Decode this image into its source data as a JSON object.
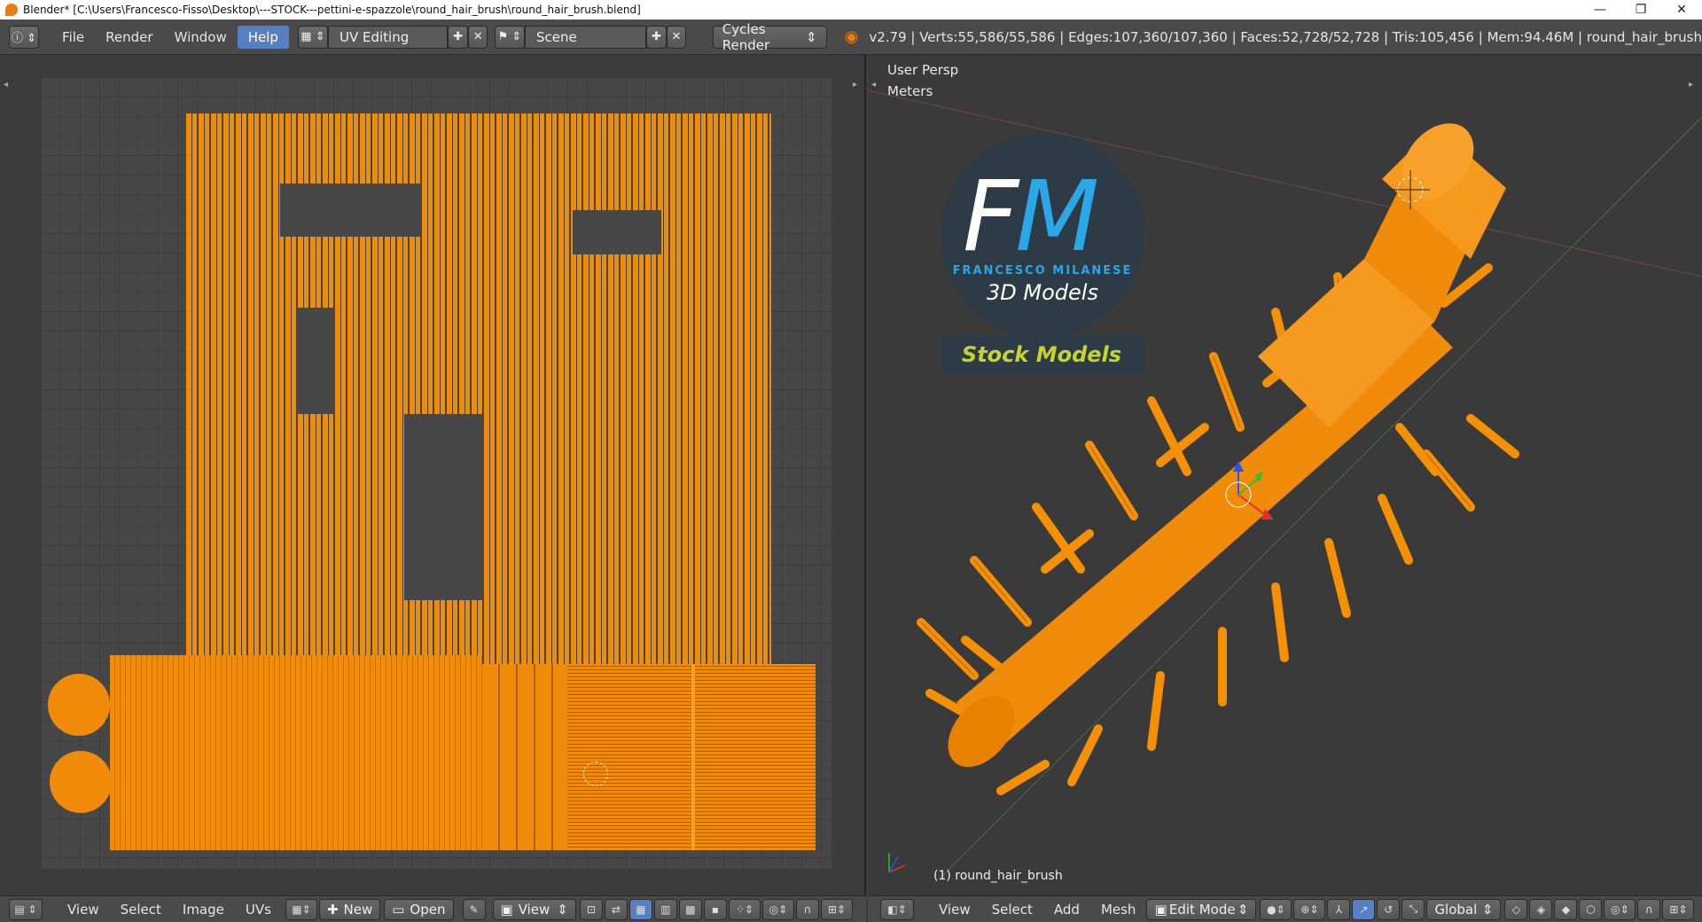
{
  "window": {
    "title": "Blender* [C:\\Users\\Francesco-Fisso\\Desktop\\---STOCK---pettini-e-spazzole\\round_hair_brush\\round_hair_brush.blend]",
    "minimize": "—",
    "maximize": "❐",
    "close": "✕"
  },
  "infobar": {
    "menus": [
      "File",
      "Render",
      "Window",
      "Help"
    ],
    "active_menu": "Help",
    "layout": "UV Editing",
    "scene": "Scene",
    "engine": "Cycles Render",
    "stats": "v2.79 | Verts:55,586/55,586 | Edges:107,360/107,360 | Faces:52,728/52,728 | Tris:105,456 | Mem:94.46M | round_hair_brush"
  },
  "viewport": {
    "persp": "User Persp",
    "units": "Meters",
    "object_label": "(1) round_hair_brush",
    "logo_letters_f": "F",
    "logo_letters_m": "M",
    "logo_brand": "FRANCESCO MILANESE",
    "logo_sub": "3D Models",
    "stock_label": "Stock Models"
  },
  "uv_header": {
    "menus": [
      "View",
      "Select",
      "Image",
      "UVs"
    ],
    "new_label": "New",
    "open_label": "Open",
    "view_label": "View"
  },
  "view3d_header": {
    "menus": [
      "View",
      "Select",
      "Add",
      "Mesh"
    ],
    "mode": "Edit Mode",
    "orientation": "Global"
  },
  "colors": {
    "accent": "#5680c2",
    "selection_orange": "#f18b0a",
    "logo_blue": "#2aa7e6",
    "stock_yellow": "#c6d52a"
  }
}
